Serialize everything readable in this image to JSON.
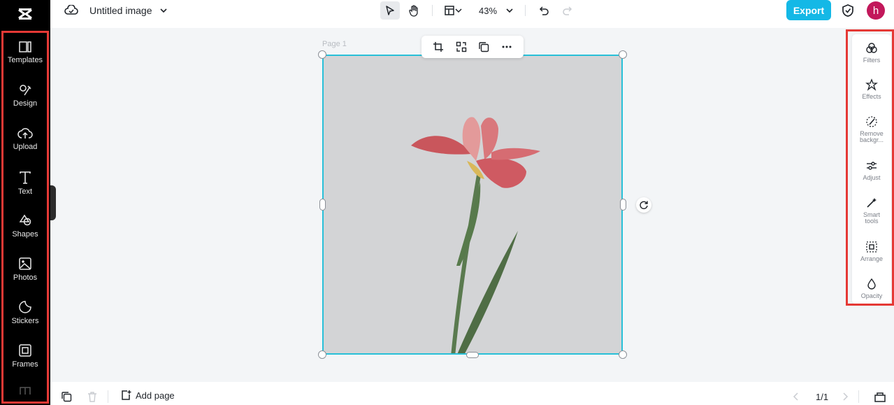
{
  "header": {
    "title": "Untitled image",
    "zoom": "43%",
    "export_label": "Export",
    "avatar_initial": "h"
  },
  "sidebar": {
    "items": [
      {
        "label": "Templates",
        "icon": "templates-icon"
      },
      {
        "label": "Design",
        "icon": "design-icon"
      },
      {
        "label": "Upload",
        "icon": "upload-icon"
      },
      {
        "label": "Text",
        "icon": "text-icon"
      },
      {
        "label": "Shapes",
        "icon": "shapes-icon"
      },
      {
        "label": "Photos",
        "icon": "photos-icon"
      },
      {
        "label": "Stickers",
        "icon": "stickers-icon"
      },
      {
        "label": "Frames",
        "icon": "frames-icon"
      }
    ]
  },
  "canvas": {
    "page_label": "Page 1"
  },
  "right_panel": {
    "items": [
      {
        "label": "Filters",
        "icon": "filters-icon"
      },
      {
        "label": "Effects",
        "icon": "effects-icon"
      },
      {
        "label": "Remove backgr...",
        "icon": "remove-background-icon"
      },
      {
        "label": "Adjust",
        "icon": "adjust-icon"
      },
      {
        "label": "Smart tools",
        "icon": "smart-tools-icon"
      },
      {
        "label": "Arrange",
        "icon": "arrange-icon"
      },
      {
        "label": "Opacity",
        "icon": "opacity-icon"
      }
    ]
  },
  "footer": {
    "add_page_label": "Add page",
    "page_indicator": "1/1"
  },
  "colors": {
    "accent": "#14b8e6",
    "selection": "#28c0d8",
    "highlight": "#e53935",
    "avatar": "#c2185b"
  }
}
